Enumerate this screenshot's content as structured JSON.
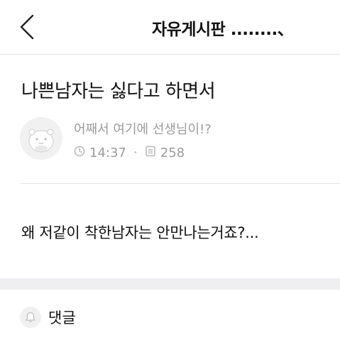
{
  "header": {
    "back_icon": "chevron-left-icon",
    "board_title": "자유게시판 ........、"
  },
  "post": {
    "title": "나쁜남자는 싫다고 하면서",
    "author": "어째서 여기에 선생님이!?",
    "time": "14:37",
    "separator": "•",
    "views": "258",
    "body": "왜 저같이 착한남자는 안만나는거죠?..."
  },
  "comments": {
    "icon": "bell-icon",
    "label": "댓글"
  },
  "colors": {
    "meta_text": "#9b9b9b",
    "divider": "#e2e2e2",
    "band": "#efeff2"
  }
}
